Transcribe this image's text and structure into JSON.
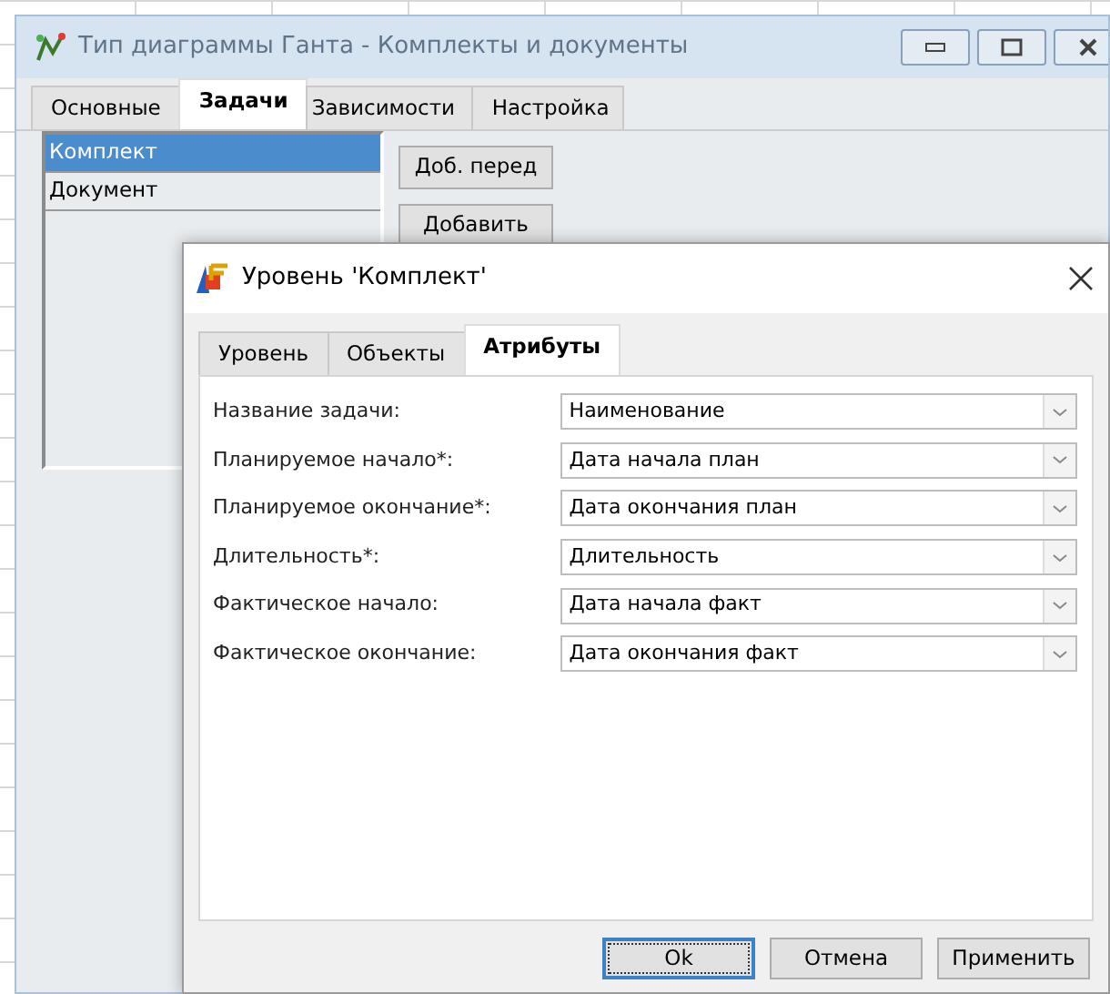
{
  "main_window": {
    "title": "Тип диаграммы Ганта - Комплекты и документы",
    "tabs": [
      {
        "label": "Основные",
        "selected": false
      },
      {
        "label": "Задачи",
        "selected": true
      },
      {
        "label": "Зависимости",
        "selected": false
      },
      {
        "label": "Настройка",
        "selected": false
      }
    ],
    "levels": [
      {
        "label": "Комплект",
        "selected": true
      },
      {
        "label": "Документ",
        "selected": false
      }
    ],
    "buttons": [
      "Доб. перед",
      "Добавить"
    ]
  },
  "dialog": {
    "title": "Уровень 'Комплект'",
    "tabs": [
      {
        "label": "Уровень",
        "selected": false
      },
      {
        "label": "Объекты",
        "selected": false
      },
      {
        "label": "Атрибуты",
        "selected": true
      }
    ],
    "fields": [
      {
        "label": "Название задачи:",
        "value": "Наименование"
      },
      {
        "label": "Планируемое начало*:",
        "value": "Дата начала план"
      },
      {
        "label": "Планируемое окончание*:",
        "value": "Дата окончания план"
      },
      {
        "label": "Длительность*:",
        "value": "Длительность"
      },
      {
        "label": "Фактическое начало:",
        "value": "Дата начала факт"
      },
      {
        "label": "Фактическое окончание:",
        "value": "Дата окончания факт"
      }
    ],
    "buttons": [
      {
        "label": "Ok",
        "default": true
      },
      {
        "label": "Отмена",
        "default": false
      },
      {
        "label": "Применить",
        "default": false
      }
    ]
  }
}
